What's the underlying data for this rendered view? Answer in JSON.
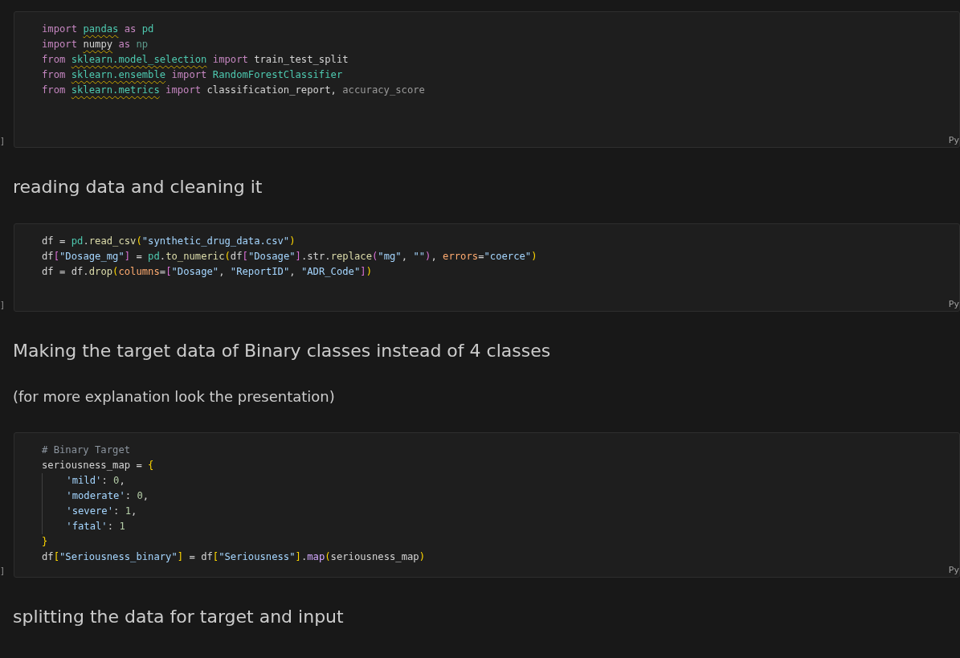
{
  "cells": [
    {
      "kind": "code",
      "run_marker": "]",
      "language": "Py",
      "lines": [
        {
          "indent_guide": false,
          "tokens": [
            {
              "text": "import ",
              "kind": "kw"
            },
            {
              "text": "pandas",
              "kind": "mod",
              "squiggle": true
            },
            {
              "text": " as ",
              "kind": "kw"
            },
            {
              "text": "pd",
              "kind": "mod"
            }
          ]
        },
        {
          "indent_guide": false,
          "tokens": [
            {
              "text": "import ",
              "kind": "kw"
            },
            {
              "text": "numpy",
              "kind": "var",
              "squiggle": true
            },
            {
              "text": " as ",
              "kind": "kw"
            },
            {
              "text": "np",
              "kind": "unused_mod"
            }
          ]
        },
        {
          "indent_guide": false,
          "tokens": [
            {
              "text": "from ",
              "kind": "kw"
            },
            {
              "text": "sklearn.model_selection",
              "kind": "mod",
              "squiggle": true
            },
            {
              "text": " import ",
              "kind": "kw"
            },
            {
              "text": "train_test_split",
              "kind": "var"
            }
          ]
        },
        {
          "indent_guide": false,
          "tokens": [
            {
              "text": "from ",
              "kind": "kw"
            },
            {
              "text": "sklearn.ensemble",
              "kind": "mod",
              "squiggle": true
            },
            {
              "text": " import ",
              "kind": "kw"
            },
            {
              "text": "RandomForestClassifier",
              "kind": "mod"
            }
          ]
        },
        {
          "indent_guide": false,
          "tokens": [
            {
              "text": "from ",
              "kind": "kw"
            },
            {
              "text": "sklearn.metrics",
              "kind": "mod",
              "squiggle": true
            },
            {
              "text": " import ",
              "kind": "kw"
            },
            {
              "text": "classification_report",
              "kind": "var"
            },
            {
              "text": ", ",
              "kind": "plain"
            },
            {
              "text": "accuracy_score",
              "kind": "unused"
            }
          ]
        }
      ]
    },
    {
      "kind": "heading",
      "text": "reading data and cleaning it"
    },
    {
      "kind": "code",
      "run_marker": "]",
      "language": "Py",
      "lines": [
        {
          "indent_guide": false,
          "tokens": [
            {
              "text": "df = ",
              "kind": "plain"
            },
            {
              "text": "pd",
              "kind": "mod"
            },
            {
              "text": ".",
              "kind": "plain"
            },
            {
              "text": "read_csv",
              "kind": "fn"
            },
            {
              "text": "(",
              "kind": "paren"
            },
            {
              "text": "\"synthetic_drug_data.csv\"",
              "kind": "str"
            },
            {
              "text": ")",
              "kind": "paren"
            }
          ]
        },
        {
          "indent_guide": false,
          "tokens": [
            {
              "text": "df",
              "kind": "plain"
            },
            {
              "text": "[",
              "kind": "bracket"
            },
            {
              "text": "\"Dosage_mg\"",
              "kind": "str"
            },
            {
              "text": "]",
              "kind": "bracket"
            },
            {
              "text": " = ",
              "kind": "plain"
            },
            {
              "text": "pd",
              "kind": "mod"
            },
            {
              "text": ".",
              "kind": "plain"
            },
            {
              "text": "to_numeric",
              "kind": "fn"
            },
            {
              "text": "(",
              "kind": "paren"
            },
            {
              "text": "df",
              "kind": "plain"
            },
            {
              "text": "[",
              "kind": "bracket"
            },
            {
              "text": "\"Dosage\"",
              "kind": "str"
            },
            {
              "text": "]",
              "kind": "bracket"
            },
            {
              "text": ".str.",
              "kind": "plain"
            },
            {
              "text": "replace",
              "kind": "fn"
            },
            {
              "text": "(",
              "kind": "bracket"
            },
            {
              "text": "\"mg\"",
              "kind": "str"
            },
            {
              "text": ", ",
              "kind": "plain"
            },
            {
              "text": "\"\"",
              "kind": "str"
            },
            {
              "text": ")",
              "kind": "bracket"
            },
            {
              "text": ", ",
              "kind": "plain"
            },
            {
              "text": "errors",
              "kind": "param"
            },
            {
              "text": "=",
              "kind": "plain"
            },
            {
              "text": "\"coerce\"",
              "kind": "str"
            },
            {
              "text": ")",
              "kind": "paren"
            }
          ]
        },
        {
          "indent_guide": false,
          "tokens": [
            {
              "text": "df = df.",
              "kind": "plain"
            },
            {
              "text": "drop",
              "kind": "fn"
            },
            {
              "text": "(",
              "kind": "paren"
            },
            {
              "text": "columns",
              "kind": "param"
            },
            {
              "text": "=",
              "kind": "plain"
            },
            {
              "text": "[",
              "kind": "bracket"
            },
            {
              "text": "\"Dosage\"",
              "kind": "str"
            },
            {
              "text": ", ",
              "kind": "plain"
            },
            {
              "text": "\"ReportID\"",
              "kind": "str"
            },
            {
              "text": ", ",
              "kind": "plain"
            },
            {
              "text": "\"ADR_Code\"",
              "kind": "str"
            },
            {
              "text": "]",
              "kind": "bracket"
            },
            {
              "text": ")",
              "kind": "paren"
            }
          ]
        }
      ]
    },
    {
      "kind": "heading",
      "text": "Making the target data of Binary classes instead of 4 classes"
    },
    {
      "kind": "paragraph",
      "text": "(for more explanation look the presentation)"
    },
    {
      "kind": "code",
      "run_marker": "]",
      "language": "Py",
      "lines": [
        {
          "indent_guide": false,
          "tokens": [
            {
              "text": "# Binary Target",
              "kind": "comment"
            }
          ]
        },
        {
          "indent_guide": false,
          "tokens": [
            {
              "text": "seriousness_map = ",
              "kind": "plain"
            },
            {
              "text": "{",
              "kind": "paren"
            }
          ]
        },
        {
          "indent_guide": true,
          "tokens": [
            {
              "text": "    'mild'",
              "kind": "str"
            },
            {
              "text": ": ",
              "kind": "plain"
            },
            {
              "text": "0",
              "kind": "num"
            },
            {
              "text": ",",
              "kind": "plain"
            }
          ]
        },
        {
          "indent_guide": true,
          "tokens": [
            {
              "text": "    'moderate'",
              "kind": "str"
            },
            {
              "text": ": ",
              "kind": "plain"
            },
            {
              "text": "0",
              "kind": "num"
            },
            {
              "text": ",",
              "kind": "plain"
            }
          ]
        },
        {
          "indent_guide": true,
          "tokens": [
            {
              "text": "    'severe'",
              "kind": "str"
            },
            {
              "text": ": ",
              "kind": "plain"
            },
            {
              "text": "1",
              "kind": "num"
            },
            {
              "text": ",",
              "kind": "plain"
            }
          ]
        },
        {
          "indent_guide": true,
          "tokens": [
            {
              "text": "    'fatal'",
              "kind": "str"
            },
            {
              "text": ": ",
              "kind": "plain"
            },
            {
              "text": "1",
              "kind": "num"
            }
          ]
        },
        {
          "indent_guide": false,
          "tokens": [
            {
              "text": "}",
              "kind": "paren"
            }
          ]
        },
        {
          "indent_guide": false,
          "tokens": [
            {
              "text": "df",
              "kind": "plain"
            },
            {
              "text": "[",
              "kind": "paren"
            },
            {
              "text": "\"Seriousness_binary\"",
              "kind": "str"
            },
            {
              "text": "]",
              "kind": "paren"
            },
            {
              "text": " = df",
              "kind": "plain"
            },
            {
              "text": "[",
              "kind": "paren"
            },
            {
              "text": "\"Seriousness\"",
              "kind": "str"
            },
            {
              "text": "]",
              "kind": "paren"
            },
            {
              "text": ".",
              "kind": "plain"
            },
            {
              "text": "map",
              "kind": "method"
            },
            {
              "text": "(",
              "kind": "paren"
            },
            {
              "text": "seriousness_map",
              "kind": "plain"
            },
            {
              "text": ")",
              "kind": "paren"
            }
          ]
        }
      ]
    },
    {
      "kind": "heading",
      "text": "splitting the data for target and input"
    }
  ]
}
